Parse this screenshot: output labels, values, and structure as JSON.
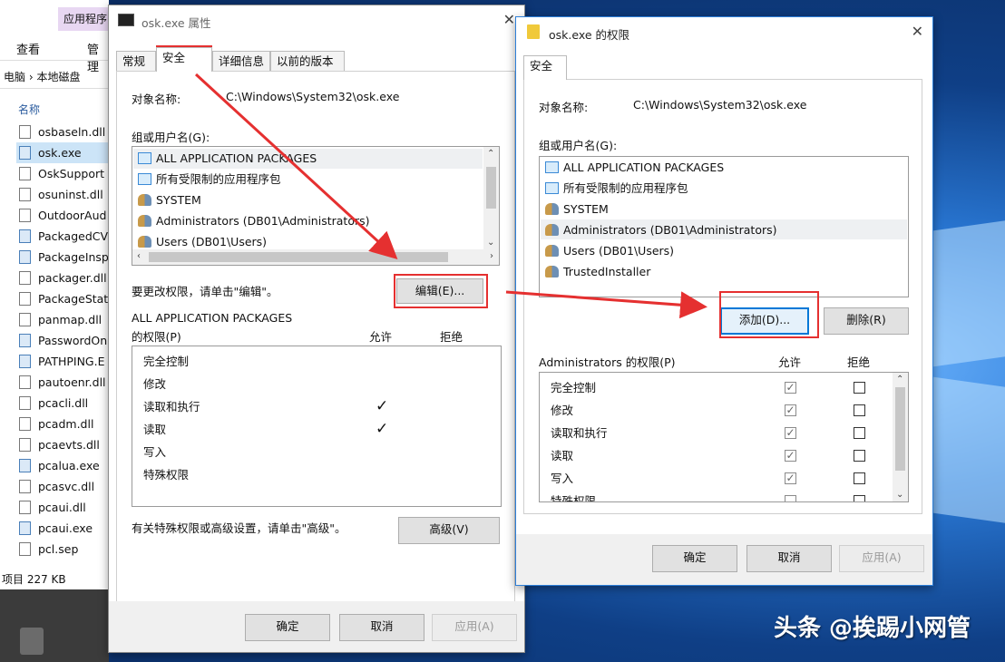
{
  "explorer": {
    "context_tab": "应用程序",
    "ribbon": [
      "查看",
      "管理"
    ],
    "address": [
      "电脑",
      "本地磁盘"
    ],
    "column_header": "名称",
    "files": [
      {
        "name": "osbaseln.dll",
        "kind": "dll",
        "selected": false
      },
      {
        "name": "osk.exe",
        "kind": "app",
        "selected": true
      },
      {
        "name": "OskSupport",
        "kind": "dll",
        "selected": false
      },
      {
        "name": "osuninst.dll",
        "kind": "dll",
        "selected": false
      },
      {
        "name": "OutdoorAud",
        "kind": "file",
        "selected": false
      },
      {
        "name": "PackagedCV",
        "kind": "app",
        "selected": false
      },
      {
        "name": "PackageInsp",
        "kind": "app",
        "selected": false
      },
      {
        "name": "packager.dll",
        "kind": "dll",
        "selected": false
      },
      {
        "name": "PackageState",
        "kind": "dll",
        "selected": false
      },
      {
        "name": "panmap.dll",
        "kind": "dll",
        "selected": false
      },
      {
        "name": "PasswordOn",
        "kind": "app",
        "selected": false
      },
      {
        "name": "PATHPING.E",
        "kind": "app",
        "selected": false
      },
      {
        "name": "pautoenr.dll",
        "kind": "dll",
        "selected": false
      },
      {
        "name": "pcacli.dll",
        "kind": "dll",
        "selected": false
      },
      {
        "name": "pcadm.dll",
        "kind": "dll",
        "selected": false
      },
      {
        "name": "pcaevts.dll",
        "kind": "dll",
        "selected": false
      },
      {
        "name": "pcalua.exe",
        "kind": "app",
        "selected": false
      },
      {
        "name": "pcasvc.dll",
        "kind": "dll",
        "selected": false
      },
      {
        "name": "pcaui.dll",
        "kind": "dll",
        "selected": false
      },
      {
        "name": "pcaui.exe",
        "kind": "app",
        "selected": false
      },
      {
        "name": "pcl.sep",
        "kind": "file",
        "selected": false
      }
    ],
    "status": "项目 227 KB"
  },
  "dialog1": {
    "title": "osk.exe 属性",
    "tabs": [
      "常规",
      "安全",
      "详细信息",
      "以前的版本"
    ],
    "object_label": "对象名称:",
    "object_value": "C:\\Windows\\System32\\osk.exe",
    "group_label": "组或用户名(G):",
    "users": [
      {
        "name": "ALL APPLICATION PACKAGES",
        "icon": "package-icon"
      },
      {
        "name": "所有受限制的应用程序包",
        "icon": "package-icon"
      },
      {
        "name": "SYSTEM",
        "icon": "users-icon"
      },
      {
        "name": "Administrators (DB01\\Administrators)",
        "icon": "users-icon"
      },
      {
        "name": "Users (DB01\\Users)",
        "icon": "users-icon"
      }
    ],
    "change_hint": "要更改权限，请单击\"编辑\"。",
    "edit_button": "编辑(E)...",
    "perm_for_line1": "ALL APPLICATION PACKAGES",
    "perm_for_line2": "的权限(P)",
    "allow": "允许",
    "deny": "拒绝",
    "permissions": [
      {
        "name": "完全控制",
        "allow": false
      },
      {
        "name": "修改",
        "allow": false
      },
      {
        "name": "读取和执行",
        "allow": true
      },
      {
        "name": "读取",
        "allow": true
      },
      {
        "name": "写入",
        "allow": false
      },
      {
        "name": "特殊权限",
        "allow": false
      }
    ],
    "advanced_hint": "有关特殊权限或高级设置，请单击\"高级\"。",
    "advanced_button": "高级(V)",
    "ok": "确定",
    "cancel": "取消",
    "apply": "应用(A)"
  },
  "dialog2": {
    "title": "osk.exe 的权限",
    "tab": "安全",
    "object_label": "对象名称:",
    "object_value": "C:\\Windows\\System32\\osk.exe",
    "group_label": "组或用户名(G):",
    "users": [
      {
        "name": "ALL APPLICATION PACKAGES",
        "icon": "package-icon"
      },
      {
        "name": "所有受限制的应用程序包",
        "icon": "package-icon"
      },
      {
        "name": "SYSTEM",
        "icon": "users-icon"
      },
      {
        "name": "Administrators (DB01\\Administrators)",
        "icon": "users-icon"
      },
      {
        "name": "Users (DB01\\Users)",
        "icon": "users-icon"
      },
      {
        "name": "TrustedInstaller",
        "icon": "users-icon"
      }
    ],
    "selected_user": "Administrators (DB01\\Administrators)",
    "add_button": "添加(D)...",
    "remove_button": "删除(R)",
    "perm_for": "Administrators 的权限(P)",
    "allow": "允许",
    "deny": "拒绝",
    "permissions": [
      {
        "name": "完全控制",
        "allow": true,
        "deny": false
      },
      {
        "name": "修改",
        "allow": true,
        "deny": false
      },
      {
        "name": "读取和执行",
        "allow": true,
        "deny": false
      },
      {
        "name": "读取",
        "allow": true,
        "deny": false
      },
      {
        "name": "写入",
        "allow": true,
        "deny": false
      },
      {
        "name": "特殊权限",
        "allow": false,
        "deny": false
      }
    ],
    "ok": "确定",
    "cancel": "取消",
    "apply": "应用(A)"
  },
  "watermark": "头条 @挨踢小网管",
  "colors": {
    "highlight": "#e53030",
    "accent": "#0078d7",
    "selection": "#cce4f7"
  }
}
